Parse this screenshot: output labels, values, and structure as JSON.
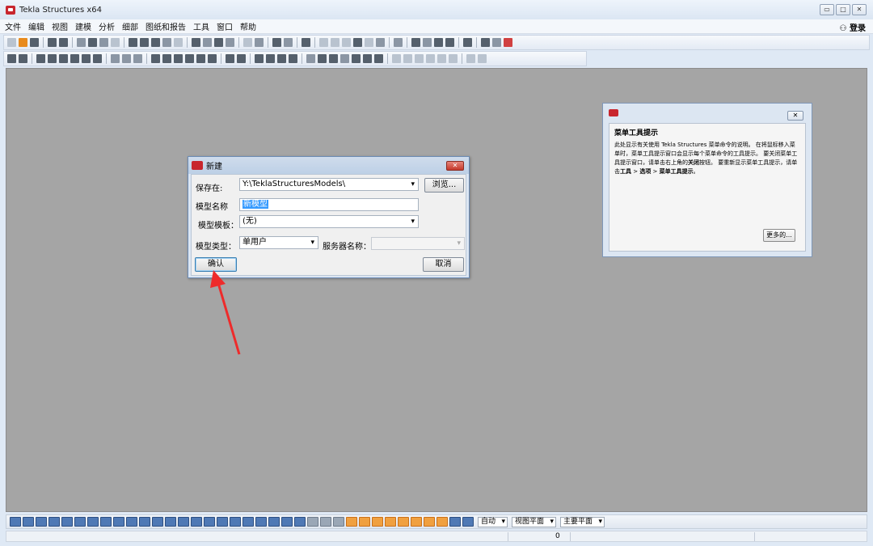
{
  "app": {
    "title": "Tekla Structures x64"
  },
  "window_buttons": [
    "▭",
    "□",
    "✕"
  ],
  "menu": [
    "文件",
    "编辑",
    "视图",
    "建模",
    "分析",
    "细部",
    "图纸和报告",
    "工具",
    "窗口",
    "帮助"
  ],
  "login_label": "⚇ 登录",
  "dialog": {
    "title": "新建",
    "save_in_label": "保存在:",
    "save_in_value": "Y:\\TeklaStructuresModels\\",
    "browse_label": "浏览...",
    "model_name_label": "模型名称",
    "model_name_value": "新模型",
    "template_label": "模型模板：",
    "template_value": "(无)",
    "model_type_label": "模型类型：",
    "model_type_value": "单用户",
    "server_label": "服务器名称：",
    "server_value": "",
    "ok_label": "确认",
    "cancel_label": "取消"
  },
  "hint": {
    "title": "菜单工具提示",
    "text_1": "此处显示有关使用 Tekla Structures 菜单命令的说明。 在将鼠标移入菜单时，菜单工具提示窗口会显示每个菜单命令的工具提示。 要关闭菜单工具提示窗口，请单击右上角的",
    "text_close": "关闭",
    "text_2": "按钮。 要重新显示菜单工具提示，请单击",
    "text_tools": "工具",
    "text_sep1": " > ",
    "text_options": "选项",
    "text_sep2": " > ",
    "text_menu_hint": "菜单工具提示",
    "text_end": "。",
    "more_label": "更多的..."
  },
  "bottom_toolbar": {
    "auto_label": "自动",
    "view_plane_label": "视图平面",
    "main_plane_label": "主要平面"
  },
  "status": {
    "count": "0"
  }
}
